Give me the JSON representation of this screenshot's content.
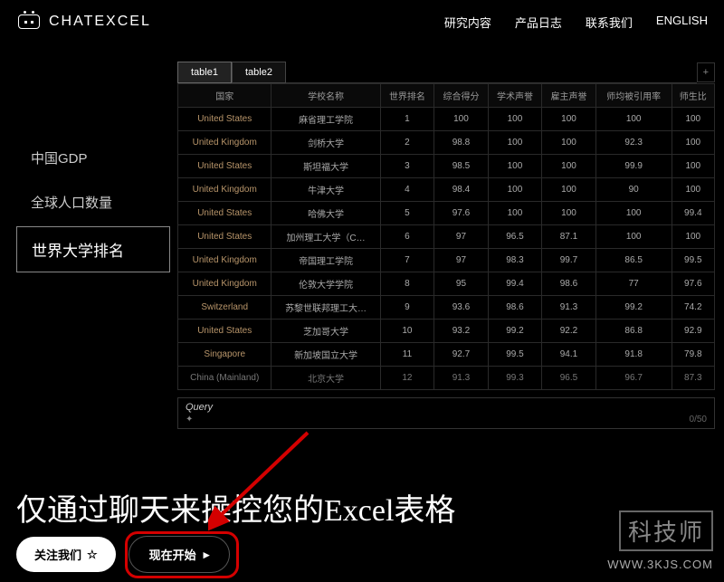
{
  "brand": "CHATEXCEL",
  "nav": [
    "研究内容",
    "产品日志",
    "联系我们",
    "ENGLISH"
  ],
  "sidebar": {
    "items": [
      "中国GDP",
      "全球人口数量",
      "世界大学排名"
    ],
    "activeIndex": 2
  },
  "tabs": {
    "items": [
      "table1",
      "table2"
    ],
    "activeIndex": 0,
    "plus": "+"
  },
  "table": {
    "headers": [
      "国家",
      "学校名称",
      "世界排名",
      "综合得分",
      "学术声誉",
      "雇主声誉",
      "师均被引用率",
      "师生比"
    ],
    "rows": [
      [
        "United States",
        "麻省理工学院",
        "1",
        "100",
        "100",
        "100",
        "100",
        "100"
      ],
      [
        "United Kingdom",
        "剑桥大学",
        "2",
        "98.8",
        "100",
        "100",
        "92.3",
        "100"
      ],
      [
        "United States",
        "斯坦福大学",
        "3",
        "98.5",
        "100",
        "100",
        "99.9",
        "100"
      ],
      [
        "United Kingdom",
        "牛津大学",
        "4",
        "98.4",
        "100",
        "100",
        "90",
        "100"
      ],
      [
        "United States",
        "哈佛大学",
        "5",
        "97.6",
        "100",
        "100",
        "100",
        "99.4"
      ],
      [
        "United States",
        "加州理工大学（C…",
        "6",
        "97",
        "96.5",
        "87.1",
        "100",
        "100"
      ],
      [
        "United Kingdom",
        "帝国理工学院",
        "7",
        "97",
        "98.3",
        "99.7",
        "86.5",
        "99.5"
      ],
      [
        "United Kingdom",
        "伦敦大学学院",
        "8",
        "95",
        "99.4",
        "98.6",
        "77",
        "97.6"
      ],
      [
        "Switzerland",
        "苏黎世联邦理工大…",
        "9",
        "93.6",
        "98.6",
        "91.3",
        "99.2",
        "74.2"
      ],
      [
        "United States",
        "芝加哥大学",
        "10",
        "93.2",
        "99.2",
        "92.2",
        "86.8",
        "92.9"
      ],
      [
        "Singapore",
        "新加坡国立大学",
        "11",
        "92.7",
        "99.5",
        "94.1",
        "91.8",
        "79.8"
      ],
      [
        "China (Mainland)",
        "北京大学",
        "12",
        "91.3",
        "99.3",
        "96.5",
        "96.7",
        "87.3"
      ]
    ]
  },
  "query": {
    "label": "Query",
    "count": "0/50"
  },
  "hero": "仅通过聊天来操控您的Excel表格",
  "buttons": {
    "follow": "关注我们",
    "star": "☆",
    "start": "现在开始",
    "arrow": "▸"
  },
  "watermark": {
    "line1": "科技师",
    "line2": "WWW.3KJS.COM"
  }
}
